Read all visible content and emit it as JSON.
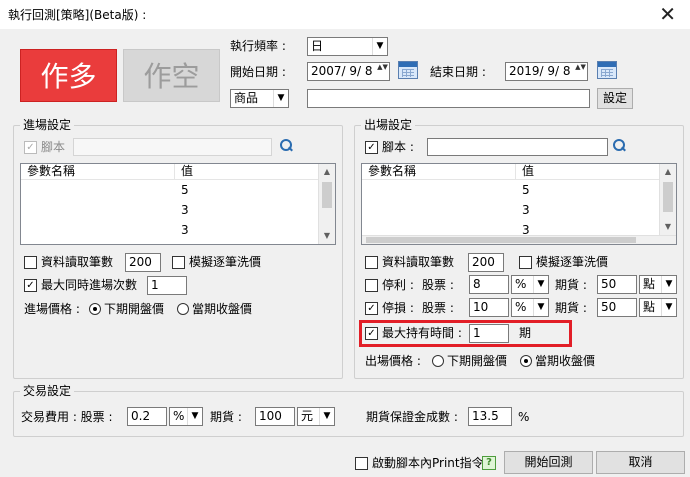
{
  "window": {
    "title": "執行回測[策略](Beta版) :",
    "close": "✕"
  },
  "mode": {
    "long": "作多",
    "short": "作空"
  },
  "frequency": {
    "label": "執行頻率 :",
    "value": "日"
  },
  "start_date": {
    "label": "開始日期 :",
    "value": "2007/ 9/ 8"
  },
  "end_date": {
    "label": "結束日期 :",
    "value": "2019/ 9/ 8"
  },
  "product": {
    "type": "商品",
    "value": "",
    "settings_button": "設定"
  },
  "entry": {
    "group_title": "進場設定",
    "script_label": "腳本",
    "script_value": "",
    "table": {
      "headers": [
        "參數名稱",
        "值"
      ],
      "rows": [
        {
          "name": "",
          "value": "5"
        },
        {
          "name": "",
          "value": "3"
        },
        {
          "name": "",
          "value": "3"
        }
      ]
    },
    "read_count_label": "資料讀取筆數",
    "read_count_value": "200",
    "simulate_label": "模擬逐筆洗價",
    "max_entries_label": "最大同時進場次數",
    "max_entries_value": "1",
    "price_label": "進場價格 :",
    "price_options": [
      "下期開盤價",
      "當期收盤價"
    ]
  },
  "exit": {
    "group_title": "出場設定",
    "script_label": "腳本 :",
    "script_value": "",
    "table": {
      "headers": [
        "參數名稱",
        "值"
      ],
      "rows": [
        {
          "name": "",
          "value": "5"
        },
        {
          "name": "",
          "value": "3"
        },
        {
          "name": "",
          "value": "3"
        }
      ]
    },
    "read_count_label": "資料讀取筆數",
    "read_count_value": "200",
    "simulate_label": "模擬逐筆洗價",
    "take_profit": {
      "label": "停利 :",
      "stock_label": "股票 :",
      "stock_value": "8",
      "stock_unit": "%",
      "futures_label": "期貨 :",
      "futures_value": "50",
      "futures_unit": "點"
    },
    "stop_loss": {
      "label": "停損 :",
      "stock_label": "股票 :",
      "stock_value": "10",
      "stock_unit": "%",
      "futures_label": "期貨 :",
      "futures_value": "50",
      "futures_unit": "點"
    },
    "max_hold_label": "最大持有時間 :",
    "max_hold_value": "1",
    "max_hold_unit": "期",
    "price_label": "出場價格 :",
    "price_options": [
      "下期開盤價",
      "當期收盤價"
    ]
  },
  "trade": {
    "group_title": "交易設定",
    "fee_label": "交易費用 : 股票 :",
    "fee_stock_value": "0.2",
    "fee_stock_unit": "%",
    "futures_label": "期貨 :",
    "fee_futures_value": "100",
    "fee_futures_unit": "元",
    "margin_label": "期貨保證金成數 :",
    "margin_value": "13.5",
    "margin_unit": "%"
  },
  "footer": {
    "print_label": "啟動腳本內Print指令",
    "help": "?",
    "start_button": "開始回測",
    "cancel_button": "取消"
  },
  "check_glyph": "✓",
  "spin_glyph": "▲▼",
  "arrow_glyph": "▼"
}
